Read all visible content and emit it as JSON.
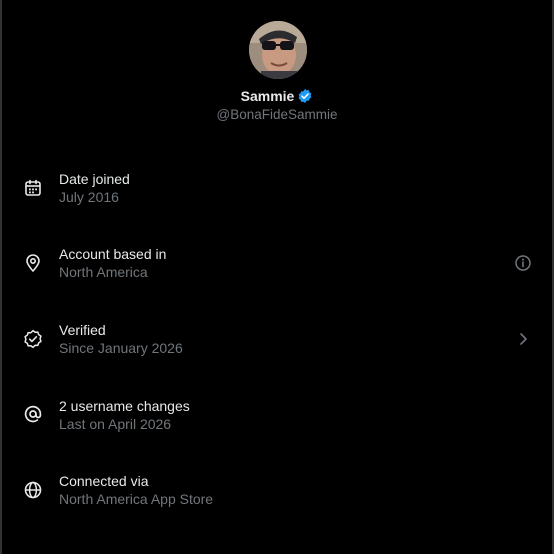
{
  "profile": {
    "display_name": "Sammie",
    "handle": "@BonaFideSammie",
    "verified": true
  },
  "colors": {
    "background": "#000000",
    "primary_text": "#e7e9ea",
    "secondary_text": "#71767b",
    "verified_badge": "#1d9bf0"
  },
  "about_items": [
    {
      "icon": "calendar-icon",
      "title": "Date joined",
      "subtitle": "July 2016"
    },
    {
      "icon": "location-pin-icon",
      "title": "Account based in",
      "subtitle": "North America",
      "trailing_icon": "info-icon"
    },
    {
      "icon": "verified-check-icon",
      "title": "Verified",
      "subtitle": "Since January 2026",
      "trailing_icon": "chevron-right-icon"
    },
    {
      "icon": "at-sign-icon",
      "title": "2 username changes",
      "subtitle": "Last on April 2026"
    },
    {
      "icon": "globe-icon",
      "title": "Connected via",
      "subtitle": "North America App Store"
    }
  ]
}
